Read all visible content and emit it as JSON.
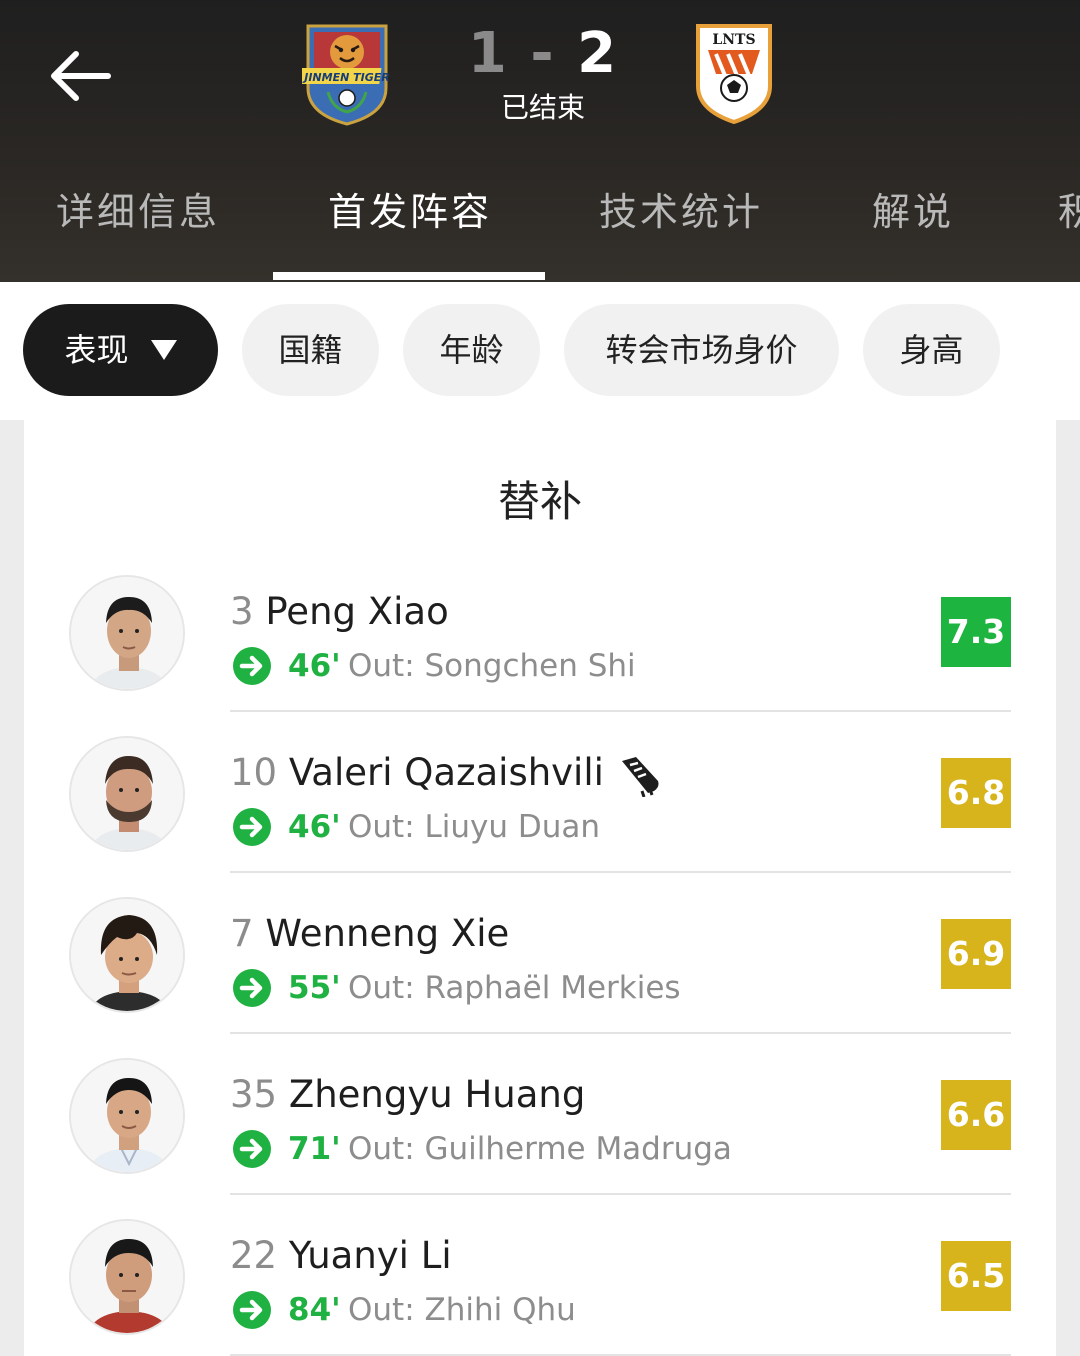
{
  "header": {
    "back_icon": "arrow-left-icon",
    "home_logo_text": "JINMEN TIGER",
    "away_logo_text": "LNTS",
    "score_home": "1",
    "score_sep": "-",
    "score_away": "2",
    "status": "已结束"
  },
  "tabs": [
    {
      "label": "详细信息",
      "active": false
    },
    {
      "label": "首发阵容",
      "active": true
    },
    {
      "label": "技术统计",
      "active": false
    },
    {
      "label": "解说",
      "active": false
    },
    {
      "label": "积",
      "active": false
    }
  ],
  "filters": {
    "performance": "表现",
    "nationality": "国籍",
    "age": "年龄",
    "market_value": "转会市场身价",
    "height": "身高"
  },
  "section": {
    "title": "替补"
  },
  "players": [
    {
      "number": "3",
      "name": "Peng Xiao",
      "minute": "46'",
      "out": "Out: Songchen Shi",
      "rating": "7.3",
      "rating_color": "#1db53f"
    },
    {
      "number": "10",
      "name": "Valeri Qazaishvili",
      "minute": "46'",
      "out": "Out: Liuyu Duan",
      "rating": "6.8",
      "rating_color": "#d7b41c",
      "icon": "boot-icon"
    },
    {
      "number": "7",
      "name": "Wenneng Xie",
      "minute": "55'",
      "out": "Out: Raphaël Merkies",
      "rating": "6.9",
      "rating_color": "#d7b41c"
    },
    {
      "number": "35",
      "name": "Zhengyu Huang",
      "minute": "71'",
      "out": "Out: Guilherme Madruga",
      "rating": "6.6",
      "rating_color": "#d7b41c"
    },
    {
      "number": "22",
      "name": "Yuanyi Li",
      "minute": "84'",
      "out": "Out: Zhihi Qhu",
      "rating": "6.5",
      "rating_color": "#d7b41c"
    }
  ],
  "colors": {
    "header_bg": "#252321",
    "accent_green": "#1fb141",
    "rating_green": "#1db53f",
    "rating_yellow": "#d7b41c"
  }
}
